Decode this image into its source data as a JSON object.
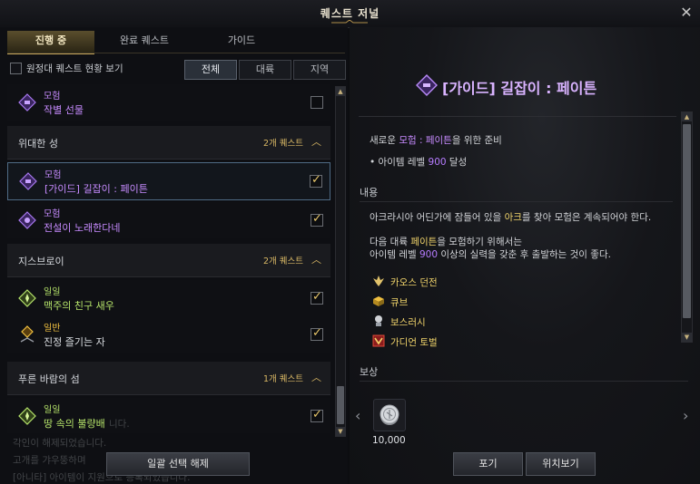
{
  "window": {
    "title": "퀘스트 저널"
  },
  "tabs": [
    {
      "label": "진행 중",
      "active": true
    },
    {
      "label": "완료 퀘스트",
      "active": false
    },
    {
      "label": "가이드",
      "active": false
    }
  ],
  "expedition_toggle": {
    "label": "원정대 퀘스트 현황 보기",
    "checked": false
  },
  "filters": [
    {
      "label": "전체",
      "active": true
    },
    {
      "label": "대륙",
      "active": false
    },
    {
      "label": "지역",
      "active": false
    }
  ],
  "quest_list": {
    "top_item": {
      "type": "모험",
      "name": "작별 선물",
      "checked": false
    },
    "sections": [
      {
        "name": "위대한 성",
        "count": "2개 퀘스트",
        "items": [
          {
            "type": "모험",
            "name": "[가이드] 길잡이 : 페이튼",
            "checked": true,
            "selected": true
          },
          {
            "type": "모험",
            "name": "전설이 노래한다네",
            "checked": true
          }
        ]
      },
      {
        "name": "지스브로이",
        "count": "2개 퀘스트",
        "items": [
          {
            "type": "일일",
            "name": "맥주의 친구 새우",
            "checked": true
          },
          {
            "type": "일반",
            "name": "진정 즐기는 자",
            "checked": true
          }
        ]
      },
      {
        "name": "푸른 바람의 섬",
        "count": "1개 퀘스트",
        "items": [
          {
            "type": "일일",
            "name": "땅 속의 불량배",
            "checked": true
          }
        ]
      }
    ]
  },
  "left_buttons": {
    "deselect_all": "일괄 선택 해제"
  },
  "detail": {
    "title": "[가이드] 길잡이 : 페이튼",
    "objective_prefix": "새로운 ",
    "objective_highlight": "모험 : 페이튼",
    "objective_suffix": "을 위한 준비",
    "requirement_prefix": "• 아이템 레벨 ",
    "requirement_value": "900",
    "requirement_suffix": " 달성",
    "content_heading": "내용",
    "content_p1_prefix": "아크라시아 어딘가에 잠들어 있을 ",
    "content_p1_highlight": "아크",
    "content_p1_suffix": "를 찾아 모험은 계속되어야 한다.",
    "content_p2_line1_prefix": "다음 대륙 ",
    "content_p2_line1_highlight": "페이튼",
    "content_p2_line1_suffix": "을 모험하기 위해서는",
    "content_p2_line2_prefix": "아이템 레벨 ",
    "content_p2_line2_value": "900",
    "content_p2_line2_suffix": " 이상의 실력을 갖춘 후 출발하는 것이 좋다.",
    "links": [
      {
        "label": "카오스 던전",
        "icon": "chaos-dungeon-icon"
      },
      {
        "label": "큐브",
        "icon": "cube-icon"
      },
      {
        "label": "보스러시",
        "icon": "boss-rush-icon"
      },
      {
        "label": "가디언 토벌",
        "icon": "guardian-raid-icon"
      }
    ],
    "reward_heading": "보상",
    "reward_amount": "10,000"
  },
  "right_buttons": {
    "abandon": "포기",
    "locate": "위치보기"
  },
  "background_chat": [
    "니다.",
    "각인이 해제되었습니다.",
    "고개를 갸우뚱하며",
    "[아니타] 아이템이 지원으로 등록되었습니다."
  ],
  "colors": {
    "gold_accent": "#d9b865",
    "adventure_purple": "#c78bff",
    "daily_green": "#b5e36a",
    "normal_yellow": "#f0c040"
  }
}
